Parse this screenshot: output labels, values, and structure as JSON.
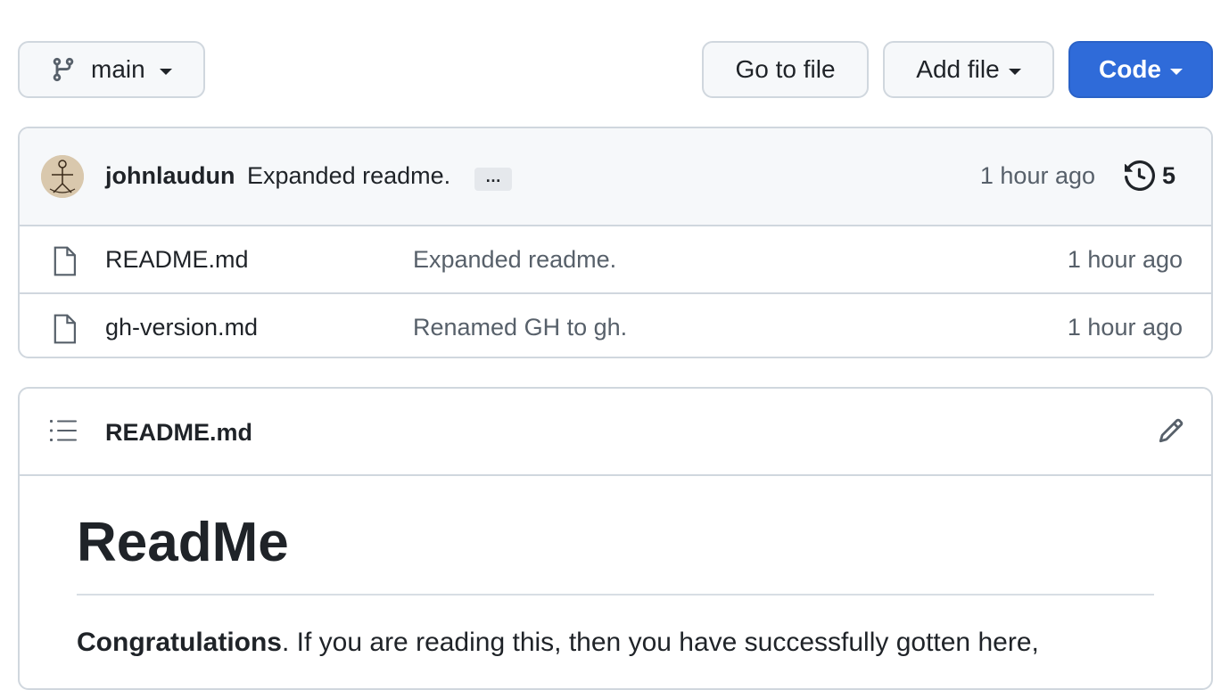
{
  "toolbar": {
    "branch_label": "main",
    "goto_label": "Go to file",
    "addfile_label": "Add file",
    "code_label": "Code"
  },
  "commit": {
    "author": "johnlaudun",
    "message": "Expanded readme.",
    "ellipsis": "…",
    "time": "1 hour ago",
    "history_count": "5"
  },
  "files": [
    {
      "name": "README.md",
      "commit": "Expanded readme.",
      "time": "1 hour ago"
    },
    {
      "name": "gh-version.md",
      "commit": "Renamed GH to gh.",
      "time": "1 hour ago"
    }
  ],
  "readme": {
    "header_title": "README.md",
    "h1": "ReadMe",
    "para_bold": "Congratulations",
    "para_rest": ". If you are reading this, then you have successfully gotten here,"
  },
  "colors": {
    "accent": "#2f6bd9",
    "border": "#d0d7de",
    "muted_text": "#57606a"
  },
  "icons": {
    "branch": "git-branch-icon",
    "file": "file-icon",
    "history": "history-icon",
    "list": "list-icon",
    "edit": "pencil-icon"
  }
}
